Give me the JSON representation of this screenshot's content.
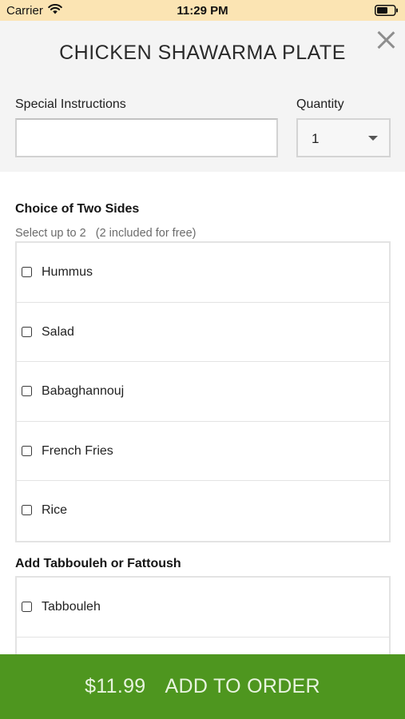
{
  "status_bar": {
    "carrier": "Carrier",
    "time": "11:29 PM"
  },
  "header": {
    "title": "CHICKEN SHAWARMA PLATE",
    "instructions_label": "Special Instructions",
    "instructions_value": "",
    "quantity_label": "Quantity",
    "quantity_value": "1"
  },
  "sections": {
    "sides": {
      "title": "Choice of Two Sides",
      "subtitle": "Select up to 2   (2 included for free)",
      "options": [
        "Hummus",
        "Salad",
        "Babaghannouj",
        "French Fries",
        "Rice"
      ]
    },
    "tabbouleh": {
      "title": "Add Tabbouleh or Fattoush",
      "options": [
        "Tabbouleh",
        ""
      ]
    }
  },
  "footer": {
    "price": "$11.99",
    "action": "ADD TO ORDER"
  },
  "colors": {
    "status_bar_bg": "#fbe4b3",
    "header_bg": "#f4f4f4",
    "add_button_bg": "#4e961f"
  }
}
